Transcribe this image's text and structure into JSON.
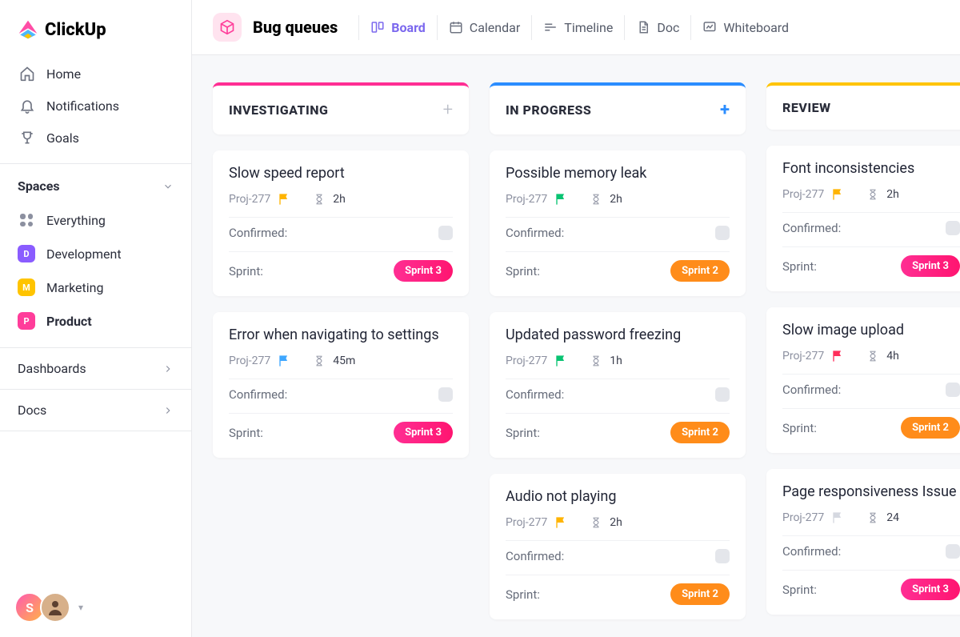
{
  "app": {
    "name": "ClickUp"
  },
  "sidebar": {
    "items": [
      {
        "label": "Home",
        "icon": "home"
      },
      {
        "label": "Notifications",
        "icon": "bell"
      },
      {
        "label": "Goals",
        "icon": "trophy"
      }
    ],
    "sectionLabel": "Spaces",
    "spaces": [
      {
        "label": "Everything",
        "kind": "everything"
      },
      {
        "label": "Development",
        "badge": "D",
        "color": "#8a5cff"
      },
      {
        "label": "Marketing",
        "badge": "M",
        "color": "#ffc400"
      },
      {
        "label": "Product",
        "badge": "P",
        "color": "#ff3d9a",
        "active": true
      }
    ],
    "footer": [
      {
        "label": "Dashboards"
      },
      {
        "label": "Docs"
      }
    ],
    "avatars": {
      "initial": "S"
    }
  },
  "header": {
    "pageTitle": "Bug queues",
    "views": [
      {
        "label": "Board",
        "icon": "board",
        "active": true
      },
      {
        "label": "Calendar",
        "icon": "calendar"
      },
      {
        "label": "Timeline",
        "icon": "timeline"
      },
      {
        "label": "Doc",
        "icon": "doc"
      },
      {
        "label": "Whiteboard",
        "icon": "whiteboard"
      }
    ]
  },
  "board": {
    "fieldLabels": {
      "confirmed": "Confirmed:",
      "sprint": "Sprint:"
    },
    "columns": [
      {
        "id": "investigating",
        "title": "INVESTIGATING",
        "plusActive": false
      },
      {
        "id": "inprogress",
        "title": "IN PROGRESS",
        "plusActive": true
      },
      {
        "id": "review",
        "title": "REVIEW"
      }
    ],
    "cards": {
      "investigating": [
        {
          "title": "Slow speed report",
          "proj": "Proj-277",
          "flagColor": "#ffb400",
          "time": "2h",
          "sprint": "Sprint 3",
          "sprintColor": "pink"
        },
        {
          "title": "Error when navigating to settings",
          "proj": "Proj-277",
          "flagColor": "#3fa7ff",
          "time": "45m",
          "sprint": "Sprint 3",
          "sprintColor": "pink"
        }
      ],
      "inprogress": [
        {
          "title": "Possible memory leak",
          "proj": "Proj-277",
          "flagColor": "#09c372",
          "time": "2h",
          "sprint": "Sprint 2",
          "sprintColor": "orange"
        },
        {
          "title": "Updated password freezing",
          "proj": "Proj-277",
          "flagColor": "#09c372",
          "time": "1h",
          "sprint": "Sprint 2",
          "sprintColor": "orange"
        },
        {
          "title": "Audio not playing",
          "proj": "Proj-277",
          "flagColor": "#ffb400",
          "time": "2h",
          "sprint": "Sprint 2",
          "sprintColor": "orange"
        }
      ],
      "review": [
        {
          "title": "Font inconsistencies",
          "proj": "Proj-277",
          "flagColor": "#ffb400",
          "time": "2h",
          "sprint": "Sprint 3",
          "sprintColor": "pink"
        },
        {
          "title": "Slow image upload",
          "proj": "Proj-277",
          "flagColor": "#ff2e5b",
          "time": "4h",
          "sprint": "Sprint 2",
          "sprintColor": "orange"
        },
        {
          "title": "Page responsiveness Issue",
          "proj": "Proj-277",
          "flagColor": "#d5d8e0",
          "time": "24",
          "sprint": "Sprint 3",
          "sprintColor": "pink"
        }
      ]
    }
  }
}
